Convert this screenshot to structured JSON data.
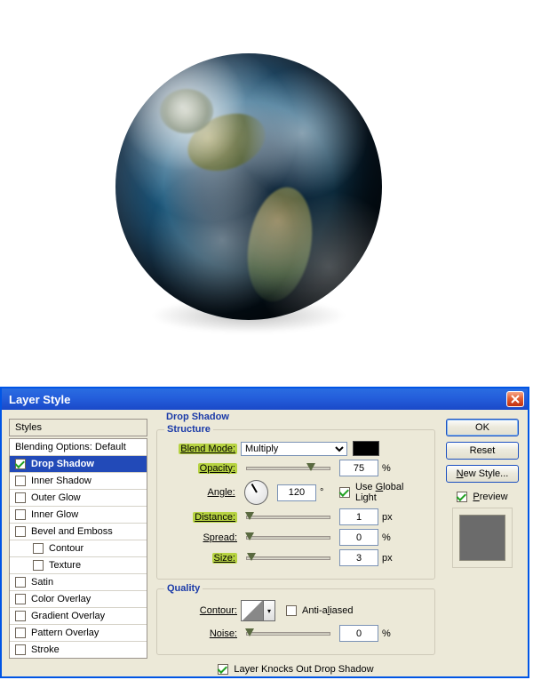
{
  "dialog": {
    "title": "Layer Style"
  },
  "styles": {
    "header": "Styles",
    "items": [
      {
        "label": "Blending Options: Default",
        "hasCheckbox": false,
        "checked": false,
        "indent": 0,
        "selected": false
      },
      {
        "label": "Drop Shadow",
        "hasCheckbox": true,
        "checked": true,
        "indent": 0,
        "selected": true
      },
      {
        "label": "Inner Shadow",
        "hasCheckbox": true,
        "checked": false,
        "indent": 0,
        "selected": false
      },
      {
        "label": "Outer Glow",
        "hasCheckbox": true,
        "checked": false,
        "indent": 0,
        "selected": false
      },
      {
        "label": "Inner Glow",
        "hasCheckbox": true,
        "checked": false,
        "indent": 0,
        "selected": false
      },
      {
        "label": "Bevel and Emboss",
        "hasCheckbox": true,
        "checked": false,
        "indent": 0,
        "selected": false
      },
      {
        "label": "Contour",
        "hasCheckbox": true,
        "checked": false,
        "indent": 1,
        "selected": false
      },
      {
        "label": "Texture",
        "hasCheckbox": true,
        "checked": false,
        "indent": 1,
        "selected": false
      },
      {
        "label": "Satin",
        "hasCheckbox": true,
        "checked": false,
        "indent": 0,
        "selected": false
      },
      {
        "label": "Color Overlay",
        "hasCheckbox": true,
        "checked": false,
        "indent": 0,
        "selected": false
      },
      {
        "label": "Gradient Overlay",
        "hasCheckbox": true,
        "checked": false,
        "indent": 0,
        "selected": false
      },
      {
        "label": "Pattern Overlay",
        "hasCheckbox": true,
        "checked": false,
        "indent": 0,
        "selected": false
      },
      {
        "label": "Stroke",
        "hasCheckbox": true,
        "checked": false,
        "indent": 0,
        "selected": false
      }
    ]
  },
  "panel": {
    "title": "Drop Shadow",
    "structure_legend": "Structure",
    "quality_legend": "Quality",
    "blend_mode_label": "Blend Mode:",
    "blend_mode_value": "Multiply",
    "color": "#000000",
    "opacity_label": "Opacity:",
    "opacity_value": "75",
    "opacity_unit": "%",
    "angle_label": "Angle:",
    "angle_value": "120",
    "angle_unit": "°",
    "global_light_label": "Use Global Light",
    "global_light_checked": true,
    "distance_label": "Distance:",
    "distance_value": "1",
    "distance_unit": "px",
    "spread_label": "Spread:",
    "spread_value": "0",
    "spread_unit": "%",
    "size_label": "Size:",
    "size_value": "3",
    "size_unit": "px",
    "contour_label": "Contour:",
    "antialias_label": "Anti-aliased",
    "antialias_checked": false,
    "noise_label": "Noise:",
    "noise_value": "0",
    "noise_unit": "%",
    "knockout_label": "Layer Knocks Out Drop Shadow",
    "knockout_checked": true
  },
  "buttons": {
    "ok": "OK",
    "reset": "Reset",
    "new_style": "New Style...",
    "preview": "Preview"
  }
}
